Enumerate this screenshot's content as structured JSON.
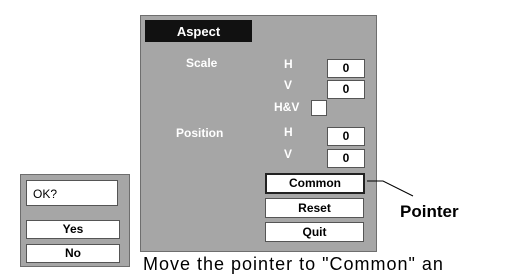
{
  "menu": {
    "title": "Aspect",
    "scale_label": "Scale",
    "position_label": "Position",
    "scale_h_label": "H",
    "scale_h_value": "0",
    "scale_v_label": "V",
    "scale_v_value": "0",
    "hv_label": "H&V",
    "position_h_label": "H",
    "position_h_value": "0",
    "position_v_label": "V",
    "position_v_value": "0",
    "common_label": "Common",
    "reset_label": "Reset",
    "quit_label": "Quit"
  },
  "ok_dialog": {
    "title": "OK?",
    "yes_label": "Yes",
    "no_label": "No"
  },
  "callout": {
    "pointer_label": "Pointer"
  },
  "instruction": {
    "text": "Move the pointer to \"Common\" an"
  }
}
